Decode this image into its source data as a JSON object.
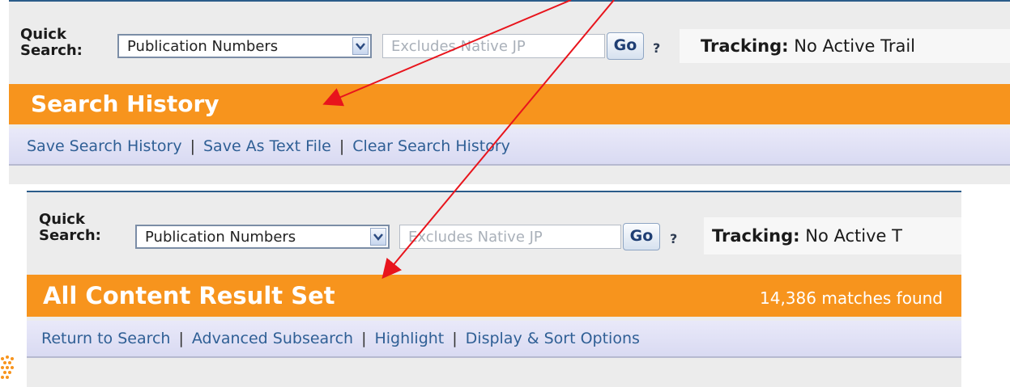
{
  "top_panel": {
    "quick_search": {
      "label_line1": "Quick",
      "label_line2": "Search:",
      "selected_option": "Publication Numbers",
      "input_placeholder": "Excludes Native JP",
      "go_label": "Go",
      "help_label": "?"
    },
    "tracking": {
      "label": "Tracking:",
      "value": "No Active Trail"
    },
    "header_title": "Search History",
    "links": [
      "Save Search History",
      "Save As Text File",
      "Clear Search History"
    ],
    "separator": "|"
  },
  "bottom_panel": {
    "quick_search": {
      "label_line1": "Quick",
      "label_line2": "Search:",
      "selected_option": "Publication Numbers",
      "input_placeholder": "Excludes Native JP",
      "go_label": "Go",
      "help_label": "?"
    },
    "tracking": {
      "label": "Tracking:",
      "value": "No Active T"
    },
    "header_title": "All Content Result Set",
    "matches": "14,386 matches found",
    "links": [
      "Return to Search",
      "Advanced Subsearch",
      "Highlight",
      "Display & Sort Options"
    ],
    "separator": "|"
  },
  "colors": {
    "header_orange": "#f7941d",
    "link_blue": "#2f5f95",
    "annotation_arrow": "#e8141c"
  },
  "icons": [
    "dropdown-arrow-icon",
    "annotation-arrow-icon"
  ]
}
